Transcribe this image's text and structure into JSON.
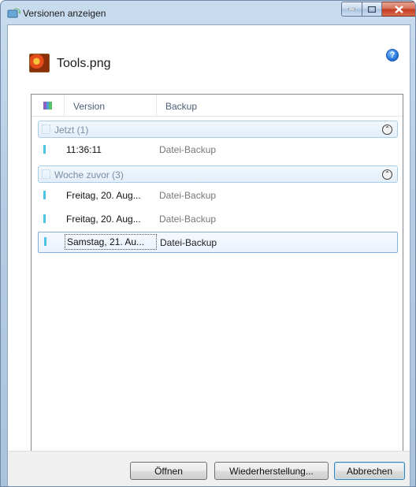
{
  "window": {
    "title": "Versionen anzeigen"
  },
  "header": {
    "filename": "Tools.png",
    "help_glyph": "?"
  },
  "list": {
    "columns": {
      "version": "Version",
      "backup": "Backup"
    },
    "groups": [
      {
        "label": "Jetzt (1)",
        "rows": [
          {
            "version": "11:36:11",
            "backup": "Datei-Backup"
          }
        ]
      },
      {
        "label": "Woche zuvor (3)",
        "rows": [
          {
            "version": "Freitag, 20. Aug...",
            "backup": "Datei-Backup"
          },
          {
            "version": "Freitag, 20. Aug...",
            "backup": "Datei-Backup"
          },
          {
            "version": "Samstag, 21. Au...",
            "backup": "Datei-Backup",
            "selected": true
          }
        ]
      }
    ]
  },
  "footer": {
    "open_label": "Öffnen",
    "restore_label": "Wiederherstellung...",
    "cancel_label": "Abbrechen"
  },
  "icons": {
    "app": "folder-sync-icon",
    "file": "image-file-icon",
    "help": "help-icon",
    "collapse": "chevron-up-icon"
  },
  "colors": {
    "accent": "#4cc4e3",
    "selection_border": "#84acdd"
  }
}
